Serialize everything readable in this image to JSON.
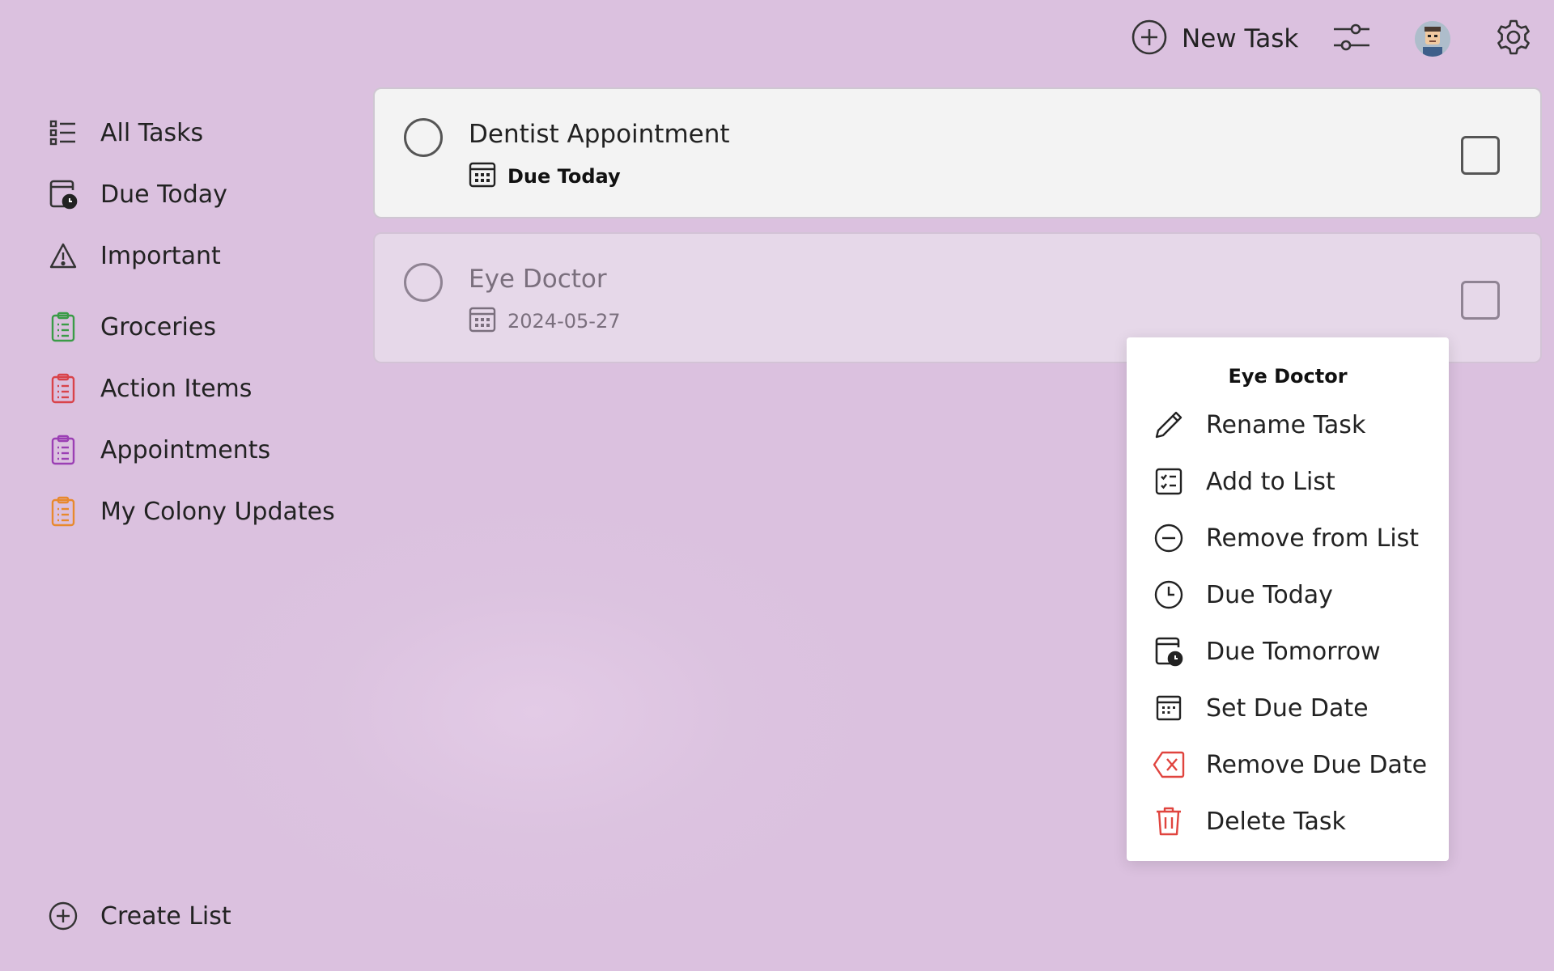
{
  "header": {
    "new_task_label": "New Task",
    "icons": [
      "plus-circle-icon",
      "filter-sliders-icon",
      "avatar",
      "gear-icon"
    ]
  },
  "sidebar": {
    "items": [
      {
        "label": "All Tasks",
        "icon": "list-icon"
      },
      {
        "label": "Due Today",
        "icon": "calendar-clock-icon"
      },
      {
        "label": "Important",
        "icon": "warning-icon"
      },
      {
        "label": "Groceries",
        "icon": "clipboard-list-icon",
        "color": "#3a9b47"
      },
      {
        "label": "Action Items",
        "icon": "clipboard-list-icon",
        "color": "#d9434a"
      },
      {
        "label": "Appointments",
        "icon": "clipboard-list-icon",
        "color": "#9b3fb4"
      },
      {
        "label": "My Colony Updates",
        "icon": "clipboard-list-icon",
        "color": "#e8892d"
      }
    ],
    "create_list_label": "Create List"
  },
  "tasks": [
    {
      "title": "Dentist Appointment",
      "due": "Due Today",
      "completed": false,
      "selected": true
    },
    {
      "title": "Eye Doctor",
      "due": "2024-05-27",
      "completed": false,
      "selected": false
    }
  ],
  "context_menu": {
    "title": "Eye Doctor",
    "items": [
      {
        "label": "Rename Task",
        "icon": "pencil-icon"
      },
      {
        "label": "Add to List",
        "icon": "checklist-icon"
      },
      {
        "label": "Remove from List",
        "icon": "minus-circle-icon"
      },
      {
        "label": "Due Today",
        "icon": "clock-icon"
      },
      {
        "label": "Due Tomorrow",
        "icon": "calendar-clock-icon"
      },
      {
        "label": "Set Due Date",
        "icon": "calendar-icon"
      },
      {
        "label": "Remove Due Date",
        "icon": "backspace-x-icon",
        "color": "#e0443e"
      },
      {
        "label": "Delete Task",
        "icon": "trash-icon",
        "color": "#e0443e"
      }
    ]
  },
  "colors": {
    "background": "#dbc1df",
    "card_active": "#f3f3f3",
    "card_dim": "#e6d8e9",
    "danger": "#e0443e"
  }
}
